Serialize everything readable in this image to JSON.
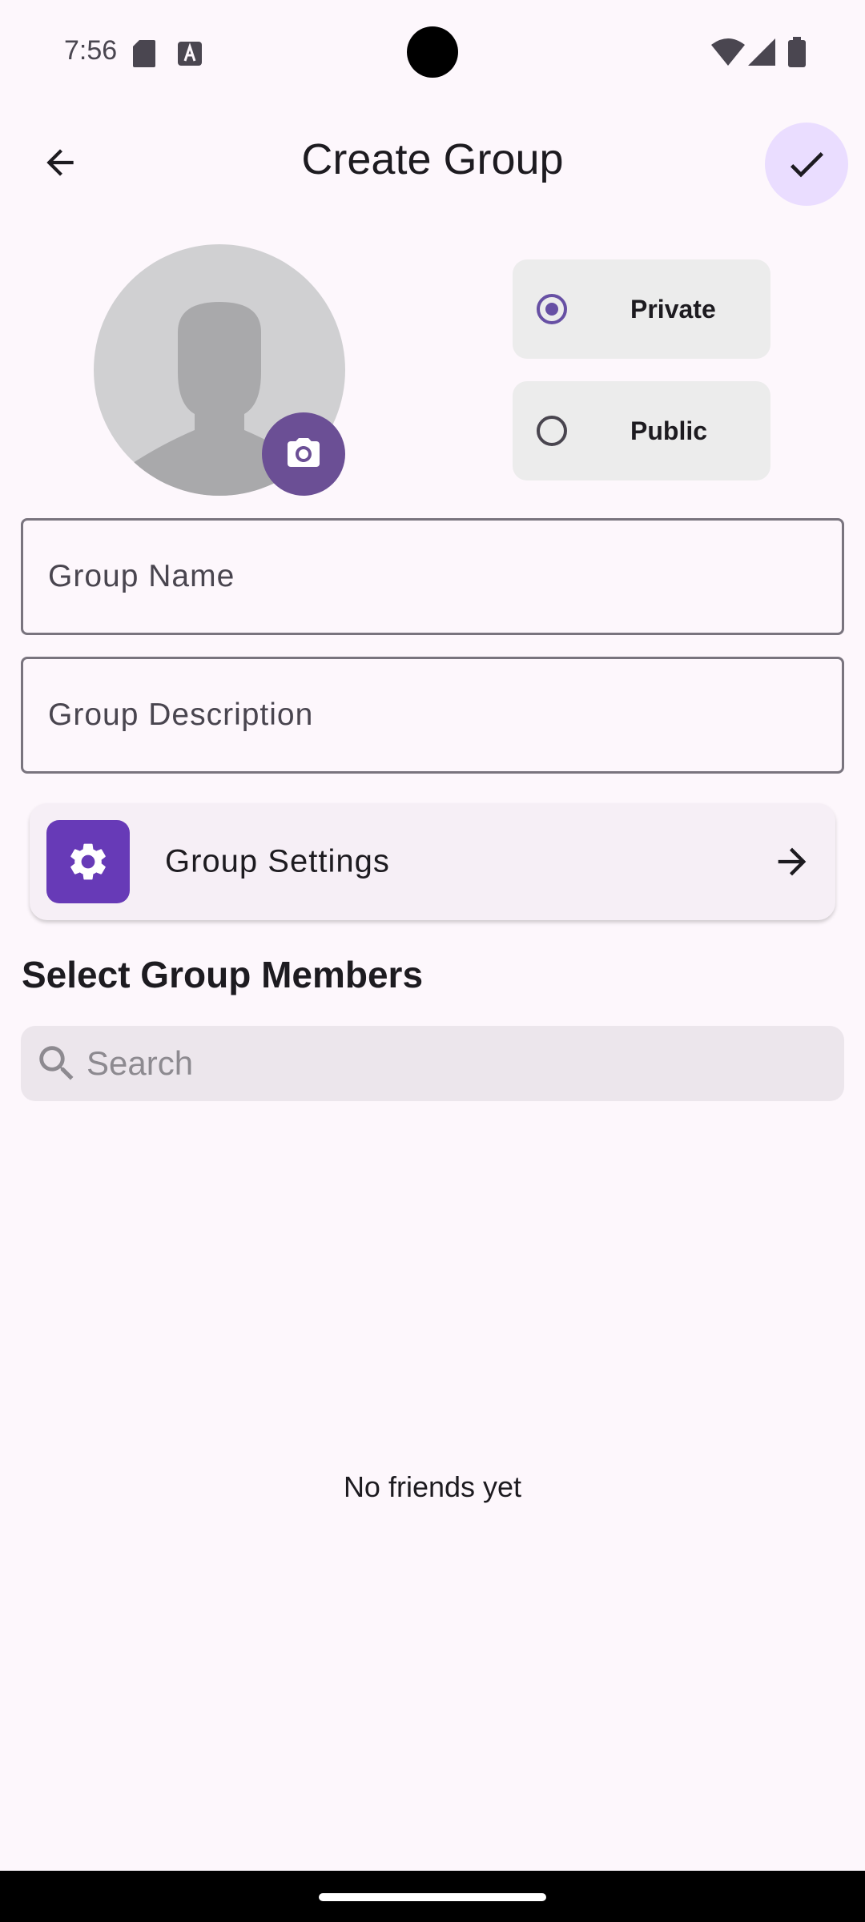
{
  "status_bar": {
    "time": "7:56",
    "icons": [
      "sd-card-icon",
      "a-font-icon",
      "wifi-icon",
      "signal-icon",
      "battery-icon"
    ]
  },
  "app_bar": {
    "title": "Create Group",
    "back_icon": "arrow-back-icon",
    "confirm_icon": "check-icon"
  },
  "avatar": {
    "placeholder_icon": "person-silhouette-icon",
    "camera_icon": "camera-icon"
  },
  "privacy": {
    "options": [
      {
        "label": "Private",
        "selected": true
      },
      {
        "label": "Public",
        "selected": false
      }
    ]
  },
  "form": {
    "name_placeholder": "Group Name",
    "description_placeholder": "Group Description"
  },
  "settings": {
    "label": "Group Settings",
    "icon": "gear-icon",
    "arrow_icon": "arrow-forward-icon"
  },
  "members": {
    "heading": "Select Group Members",
    "search_placeholder": "Search",
    "empty_text": "No friends yet"
  },
  "colors": {
    "background": "#fdf7fc",
    "accent": "#6750a4",
    "confirm_bg": "#eaddff",
    "settings_icon_bg": "#673ab7",
    "camera_btn": "#6b4f95"
  }
}
